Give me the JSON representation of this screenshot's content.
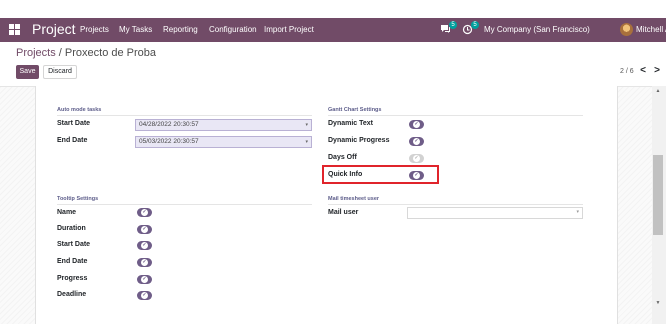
{
  "navbar": {
    "app_title": "Project",
    "menu": [
      "Projects",
      "My Tasks",
      "Reporting",
      "Configuration",
      "Import Project"
    ],
    "chat_badge": "5",
    "activity_badge": "5",
    "company": "My Company (San Francisco)",
    "user": "Mitchell Admin",
    "bg_color": "#714b67"
  },
  "breadcrumb": {
    "parent": "Projects",
    "separator": " / ",
    "current": "Proxecto de Proba"
  },
  "buttons": {
    "save": "Save",
    "discard": "Discard"
  },
  "pager": {
    "value": "2 / 6",
    "prev": "<",
    "next": ">"
  },
  "auto_mode": {
    "title": "Auto mode tasks",
    "start_label": "Start Date",
    "start_value": "04/28/2022 20:30:57",
    "end_label": "End Date",
    "end_value": "05/03/2022 20:30:57"
  },
  "gantt": {
    "title": "Gantt Chart Settings",
    "items": [
      {
        "label": "Dynamic Text",
        "on": true
      },
      {
        "label": "Dynamic Progress",
        "on": true
      },
      {
        "label": "Days Off",
        "on": false
      },
      {
        "label": "Quick Info",
        "on": true
      }
    ]
  },
  "tooltip": {
    "title": "Tooltip Settings",
    "items": [
      {
        "label": "Name",
        "on": true
      },
      {
        "label": "Duration",
        "on": true
      },
      {
        "label": "Start Date",
        "on": true
      },
      {
        "label": "End Date",
        "on": true
      },
      {
        "label": "Progress",
        "on": true
      },
      {
        "label": "Deadline",
        "on": true
      }
    ]
  },
  "mail": {
    "title": "Mail timesheet user",
    "label": "Mail user",
    "value": ""
  },
  "icons": {
    "apps": "apps-grid-icon",
    "chat": "chat-icon",
    "activity": "clock-icon",
    "caret": "▾",
    "check": "✓"
  }
}
